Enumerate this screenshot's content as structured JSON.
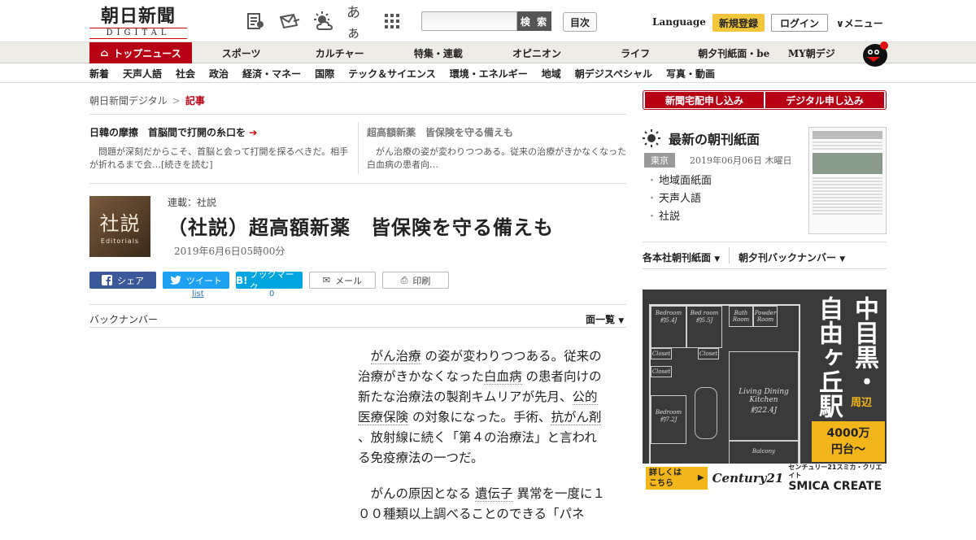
{
  "header": {
    "logo_jp": "朝日新聞",
    "logo_en": "DIGITAL",
    "search_placeholder": "",
    "search_button": "検 索",
    "mokuji": "目次",
    "language": "Language",
    "register": "新規登録",
    "login": "ログイン",
    "menu": "メニュー"
  },
  "icons": [
    "paper-icon",
    "mail-icon",
    "weather-icon",
    "font-size-icon",
    "apps-grid-icon"
  ],
  "font_size_glyph": "あぁ",
  "nav_main": [
    "トップニュース",
    "スポーツ",
    "カルチャー",
    "特集・連載",
    "オピニオン",
    "ライフ",
    "朝夕刊紙面・be",
    "MY朝デジ"
  ],
  "nav_sub": [
    "新着",
    "天声人語",
    "社会",
    "政治",
    "経済・マネー",
    "国際",
    "テック＆サイエンス",
    "環境・エネルギー",
    "地域",
    "朝デジスペシャル",
    "写真・動画"
  ],
  "breadcrumb": {
    "home": "朝日新聞デジタル",
    "sep": ">",
    "current": "記事"
  },
  "related": [
    {
      "title": "日韓の摩擦　首脳間で打開の糸口を",
      "desc": "問題が深刻だからこそ、首脳と会って打開を探るべきだ。相手が折れるまで会…[続きを読む]"
    },
    {
      "title": "超高額新薬　皆保険を守る備えも",
      "desc": "がん治療の姿が変わりつつある。従来の治療がきかなくなった白血病の患者向…"
    }
  ],
  "editorial_badge": {
    "kanji": "社説",
    "en": "Editorials"
  },
  "article": {
    "series": "連載：社説",
    "title": "（社説）超高額新薬　皆保険を守る備えも",
    "date": "2019年6月6日05時00分"
  },
  "share": {
    "facebook": "シェア",
    "twitter": "ツイート",
    "twitter_sub": "list",
    "hatena": "ブックマーク",
    "hatena_icon": "B!",
    "hatena_count": "0",
    "mail": "メール",
    "print": "印刷"
  },
  "backnumber": "バックナンバー",
  "menkan": "面一覧",
  "body": {
    "p1": {
      "a": "がん治療",
      "b": "の姿が変わりつつある。従来の治療がきかなくなった",
      "c": "白血病",
      "d": "の患者向けの新たな治療法の製剤キムリアが先月、",
      "e": "公的医療保険",
      "f": "の対象になった。手術、",
      "g": "抗がん剤",
      "h": "、放射線に続く「第４の治療法」と言われる免疫療法の一つだ。"
    },
    "p2": {
      "a": "がんの原因となる",
      "b": "遺伝子",
      "c": "異常を一度に",
      "d": "１００種類以上調べることのできる「パネ"
    }
  },
  "right": {
    "btn_delivery": "新聞宅配申し込み",
    "btn_digital": "デジタル申し込み",
    "paper_title": "最新の朝刊紙面",
    "place": "東京",
    "date": "2019年06月06日 木曜日",
    "paper_links": [
      "地域面紙面",
      "天声人語",
      "社説"
    ],
    "dd1": "各本社朝刊紙面",
    "dd2": "朝夕刊バックナンバー"
  },
  "ad": {
    "c1": "中目黒",
    "c1_dot": "・",
    "c2": "自由ヶ丘駅",
    "near": "周辺",
    "price": "4000万",
    "price2": "円台～",
    "more1": "詳しくは",
    "more2": "こちら",
    "brand1": "Century21",
    "brand2_sub": "センチュリー21スミカ・クリエイト",
    "brand2": "SMICA CREATE",
    "rooms": [
      "Bedroom",
      "Bed room",
      "Bath Room",
      "Powder Room",
      "Closet",
      "Closet",
      "Closet",
      "Living Dining Kitchen",
      "Bedroom",
      "Balcony"
    ],
    "room_sizes": [
      "約5.4J",
      "約5.5J",
      "約22.4J",
      "約7.2J"
    ]
  }
}
